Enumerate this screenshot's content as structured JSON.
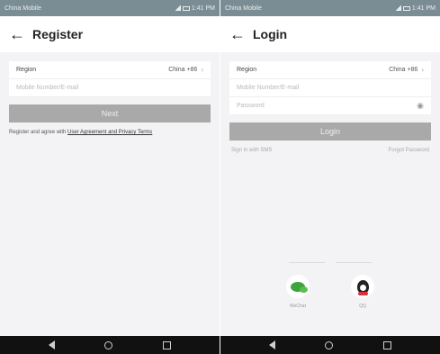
{
  "colors": {
    "status_bar": "#7b8d94",
    "button_disabled": "#a9a9a9",
    "background": "#f3f3f5"
  },
  "register": {
    "status": {
      "carrier": "China Mobile",
      "time": "1:41 PM"
    },
    "title": "Register",
    "region_label": "Region",
    "region_value": "China +86",
    "account_placeholder": "Mobile Number/E-mail",
    "next_label": "Next",
    "agree_prefix": "Register and agree with ",
    "agree_link": "User Agreement and Privacy Terms"
  },
  "login": {
    "status": {
      "carrier": "China Mobile",
      "time": "1:41 PM"
    },
    "title": "Login",
    "region_label": "Region",
    "region_value": "China +86",
    "account_placeholder": "Mobile Number/E-mail",
    "password_placeholder": "Password",
    "login_label": "Login",
    "sms_link": "Sign in with SMS",
    "forgot_link": "Forgot Password",
    "third_party": [
      {
        "label": "WeChat",
        "icon": "wechat-icon"
      },
      {
        "label": "QQ",
        "icon": "qq-icon"
      }
    ]
  }
}
